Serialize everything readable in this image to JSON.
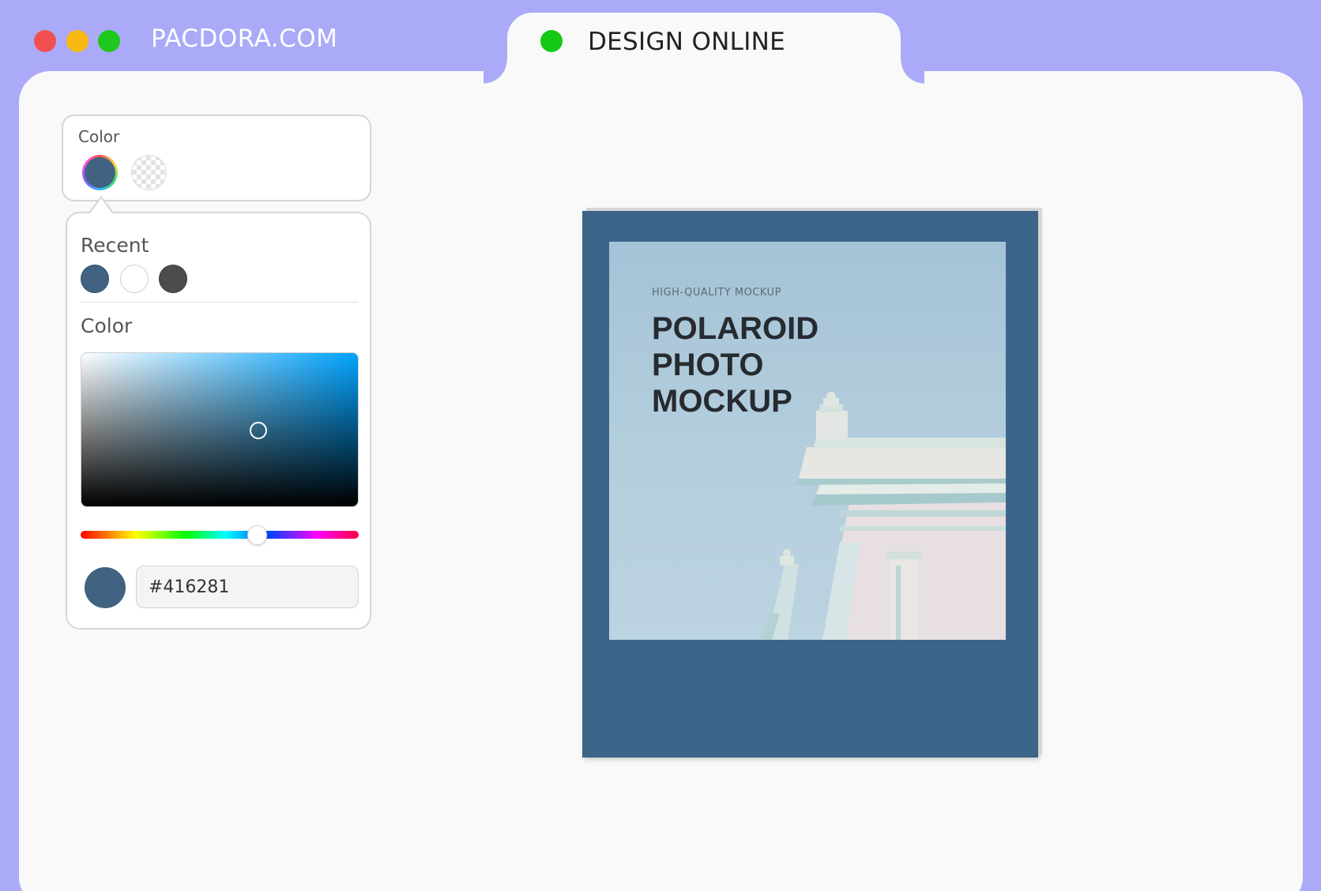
{
  "window": {
    "site_title": "PACDORA.COM",
    "tab_label": "DESIGN ONLINE"
  },
  "color_control": {
    "label": "Color",
    "swatches": [
      "color-wheel",
      "transparent"
    ]
  },
  "color_picker": {
    "recent_label": "Recent",
    "recent_colors": [
      "#416281",
      "#ffffff",
      "#4c4c4c"
    ],
    "color_label": "Color",
    "hex_value": "#416281"
  },
  "mockup": {
    "frame_color": "#416281",
    "subtitle": "HIGH-QUALITY MOCKUP",
    "title_lines": [
      "POLAROID",
      "PHOTO",
      "MOCKUP"
    ]
  },
  "colors": {
    "background": "#aaaaf8",
    "accent_green": "#14c814"
  }
}
